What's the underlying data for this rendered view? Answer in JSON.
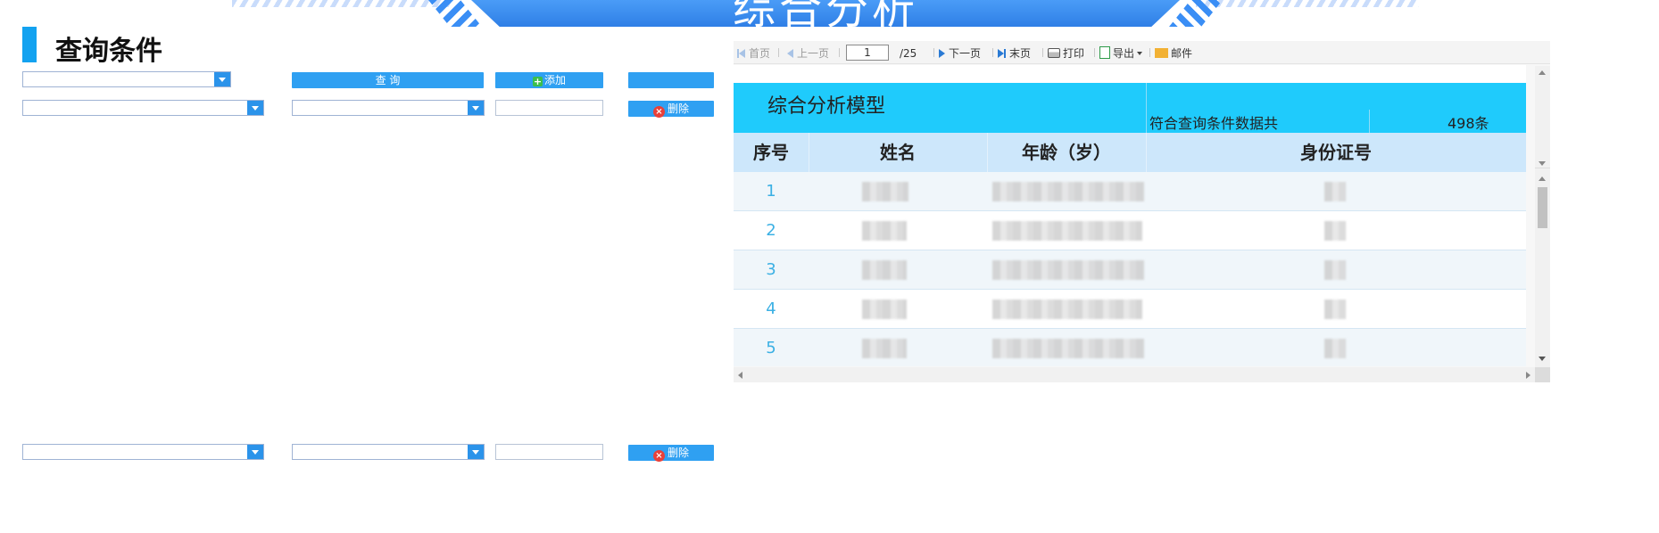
{
  "banner": {
    "title": "综合分析"
  },
  "query_panel": {
    "title": "查询条件",
    "query_label": "查 询",
    "add_label": "添加",
    "delete_label": "删除",
    "add_icon": "+",
    "delete_icon": "×"
  },
  "toolbar": {
    "first": "首页",
    "prev": "上一页",
    "page": "1",
    "total_pages": "/25",
    "next": "下一页",
    "last": "末页",
    "print": "打印",
    "export": "导出",
    "mail": "邮件"
  },
  "report": {
    "title": "综合分析模型",
    "count_label": "符合查询条件数据共",
    "count_value": "498条",
    "columns": [
      "序号",
      "姓名",
      "年龄（岁）",
      "身份证号"
    ],
    "rows": [
      {
        "seq": "1"
      },
      {
        "seq": "2"
      },
      {
        "seq": "3"
      },
      {
        "seq": "4"
      },
      {
        "seq": "5"
      }
    ]
  },
  "colors": {
    "accent": "#2fa0f2",
    "title_row": "#1fcbfc",
    "header_row": "#cde7fb",
    "seq_text": "#3bb0e4"
  }
}
